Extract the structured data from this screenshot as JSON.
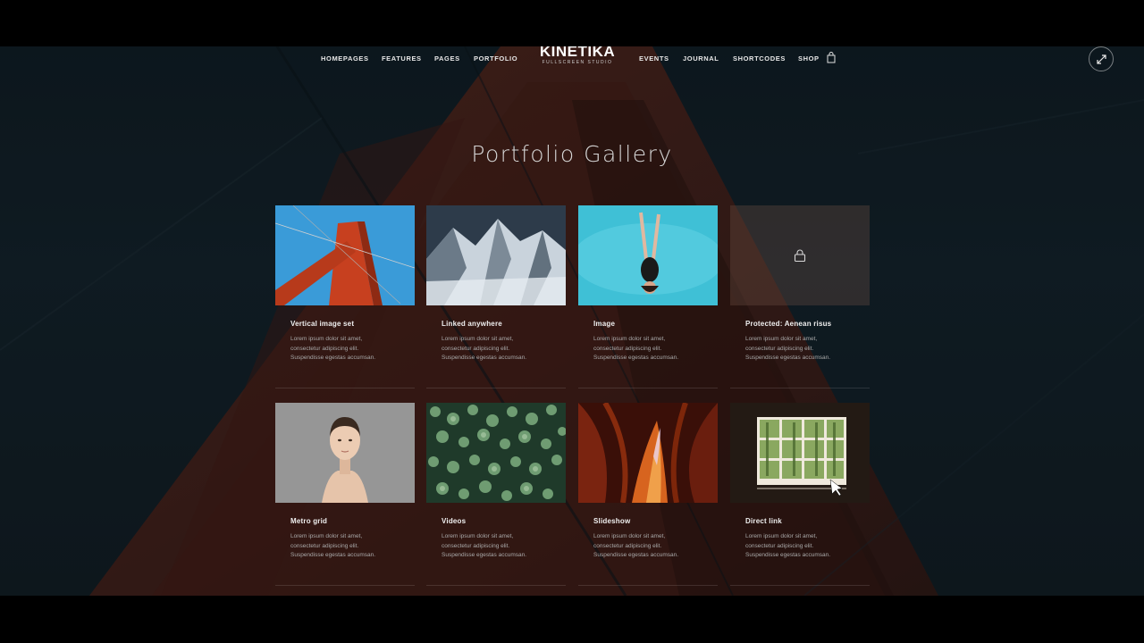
{
  "nav": {
    "left": [
      "HOMEPAGES",
      "FEATURES",
      "PAGES",
      "PORTFOLIO"
    ],
    "right": [
      "EVENTS",
      "JOURNAL",
      "SHORTCODES",
      "SHOP"
    ]
  },
  "logo": {
    "title": "KINETIKA",
    "subtitle": "FULLSCREEN STUDIO"
  },
  "page_title": "Portfolio Gallery",
  "icons": {
    "cart": "shopping-bag-icon",
    "fullscreen": "expand-icon",
    "lock": "lock-icon"
  },
  "cards": [
    {
      "title": "Vertical image set",
      "desc": [
        "Lorem ipsum dolor sit amet,",
        "consectetur adipiscing elit.",
        "Suspendisse egestas accumsan."
      ]
    },
    {
      "title": "Linked anywhere",
      "desc": [
        "Lorem ipsum dolor sit amet,",
        "consectetur adipiscing elit.",
        "Suspendisse egestas accumsan."
      ]
    },
    {
      "title": "Image",
      "desc": [
        "Lorem ipsum dolor sit amet,",
        "consectetur adipiscing elit.",
        "Suspendisse egestas accumsan."
      ]
    },
    {
      "title": "Protected: Aenean risus",
      "desc": [
        "Lorem ipsum dolor sit amet,",
        "consectetur adipiscing elit.",
        "Suspendisse egestas accumsan."
      ]
    },
    {
      "title": "Metro grid",
      "desc": [
        "Lorem ipsum dolor sit amet,",
        "consectetur adipiscing elit.",
        "Suspendisse egestas accumsan."
      ]
    },
    {
      "title": "Videos",
      "desc": [
        "Lorem ipsum dolor sit amet,",
        "consectetur adipiscing elit.",
        "Suspendisse egestas accumsan."
      ]
    },
    {
      "title": "Slideshow",
      "desc": [
        "Lorem ipsum dolor sit amet,",
        "consectetur adipiscing elit.",
        "Suspendisse egestas accumsan."
      ]
    },
    {
      "title": "Direct link",
      "desc": [
        "Lorem ipsum dolor sit amet,",
        "consectetur adipiscing elit.",
        "Suspendisse egestas accumsan."
      ]
    }
  ],
  "colors": {
    "background": "#13222b",
    "bridge": "#5a2218",
    "text": "#f0f0f0",
    "muted": "#a9a9a9"
  }
}
